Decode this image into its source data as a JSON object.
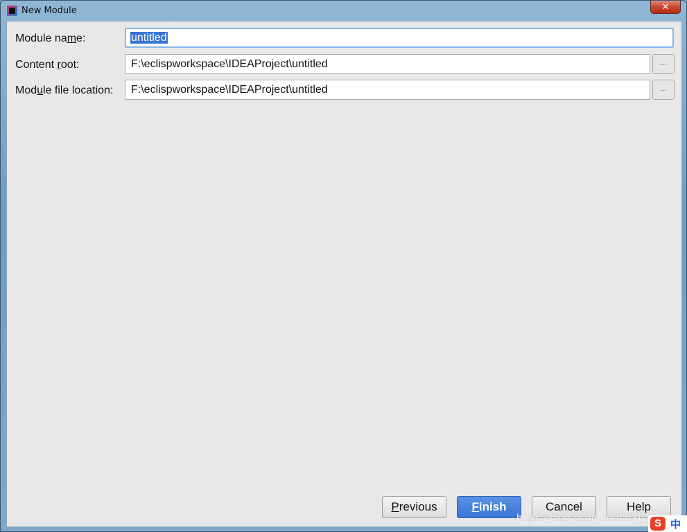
{
  "window": {
    "title": "New Module",
    "close_icon": "close-icon"
  },
  "form": {
    "module_name": {
      "label_pre": "Module na",
      "label_key": "m",
      "label_post": "e:",
      "value": "untitled"
    },
    "content_root": {
      "label_pre": "Content ",
      "label_key": "r",
      "label_post": "oot:",
      "value": "F:\\eclispworkspace\\IDEAProject\\untitled",
      "browse": "..."
    },
    "module_file_location": {
      "label_pre": "Mod",
      "label_key": "u",
      "label_post": "le file location:",
      "value": "F:\\eclispworkspace\\IDEAProject\\untitled",
      "browse": "..."
    }
  },
  "buttons": {
    "previous": {
      "key": "P",
      "rest": "revious"
    },
    "finish": {
      "key": "F",
      "rest": "inish"
    },
    "cancel": "Cancel",
    "help": "Help"
  },
  "overlay": {
    "watermark": "https://blog.csdn.net/LuYi_WeiLin",
    "ime_logo": "S",
    "ime_mode": "中"
  },
  "colors": {
    "accent": "#3a75d4",
    "selection": "#3875d7",
    "background": "#e8e8e8"
  }
}
